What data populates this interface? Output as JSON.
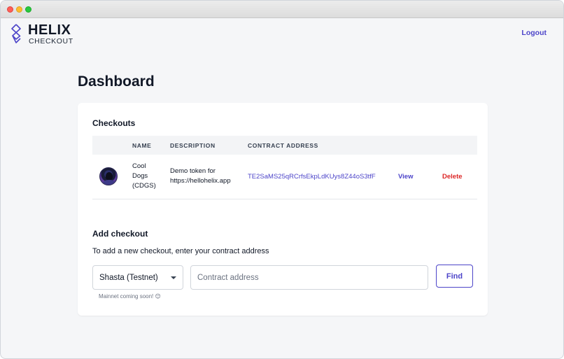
{
  "window": {
    "title": ""
  },
  "header": {
    "logo_title": "HELIX",
    "logo_subtitle": "CHECKOUT",
    "logout_label": "Logout"
  },
  "page": {
    "title": "Dashboard"
  },
  "checkouts": {
    "title": "Checkouts",
    "columns": [
      "",
      "NAME",
      "DESCRIPTION",
      "CONTRACT ADDRESS",
      "",
      ""
    ],
    "rows": [
      {
        "avatar": "token-avatar",
        "name": "Cool Dogs (CDGS)",
        "description": "Demo token for https://hellohelix.app",
        "contract_address": "TE2SaMS25qRCrfsEkpLdKUys8Z44oS3tfF",
        "view_label": "View",
        "delete_label": "Delete"
      }
    ]
  },
  "add_checkout": {
    "title": "Add checkout",
    "description": "To add a new checkout, enter your contract address",
    "network_selected": "Shasta (Testnet)",
    "address_placeholder": "Contract address",
    "find_label": "Find",
    "hint": "Mainnet coming soon! 😊"
  },
  "colors": {
    "accent": "#4c44c9",
    "danger": "#dc2626",
    "background": "#f5f6f8"
  },
  "icons": {
    "logo": "helix-logo-icon",
    "select_caret": "chevron-down-icon"
  }
}
